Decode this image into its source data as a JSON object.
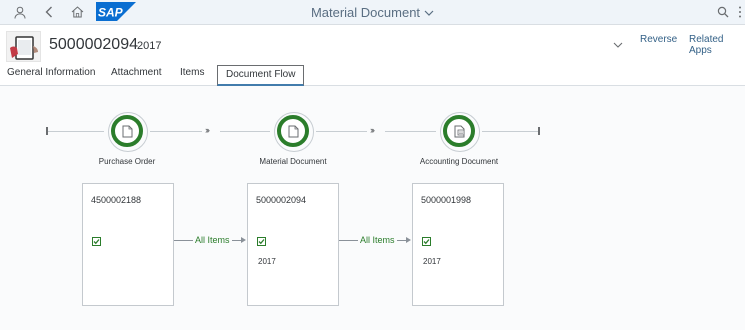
{
  "shell": {
    "logo_text": "SAP",
    "app_title": "Material Document",
    "icons": [
      "user-icon",
      "back-icon",
      "home-icon",
      "search-icon",
      "more-icon"
    ]
  },
  "header": {
    "document_number": "5000002094",
    "year": "2017",
    "actions": {
      "reverse": "Reverse",
      "related_apps": "Related Apps"
    }
  },
  "tabs": [
    {
      "label": "General Information",
      "selected": false
    },
    {
      "label": "Attachment",
      "selected": false
    },
    {
      "label": "Items",
      "selected": false
    },
    {
      "label": "Document Flow",
      "selected": true
    }
  ],
  "flow": {
    "nodes": [
      {
        "label": "Purchase Order",
        "icon": "document-icon"
      },
      {
        "label": "Material Document",
        "icon": "document-icon"
      },
      {
        "label": "Accounting Document",
        "icon": "accounting-document-icon"
      }
    ],
    "arrows": "›››",
    "cards": [
      {
        "number": "4500002188",
        "checked": true,
        "year": ""
      },
      {
        "number": "5000002094",
        "checked": true,
        "year": "2017"
      },
      {
        "number": "5000001998",
        "checked": true,
        "year": "2017"
      }
    ],
    "links": [
      {
        "label": "All Items"
      },
      {
        "label": "All Items"
      }
    ]
  },
  "colors": {
    "accent_green": "#2b7d2b",
    "shell_bg": "#eff4f9",
    "sap_blue": "#0a6ed1",
    "link_blue": "#346187"
  }
}
